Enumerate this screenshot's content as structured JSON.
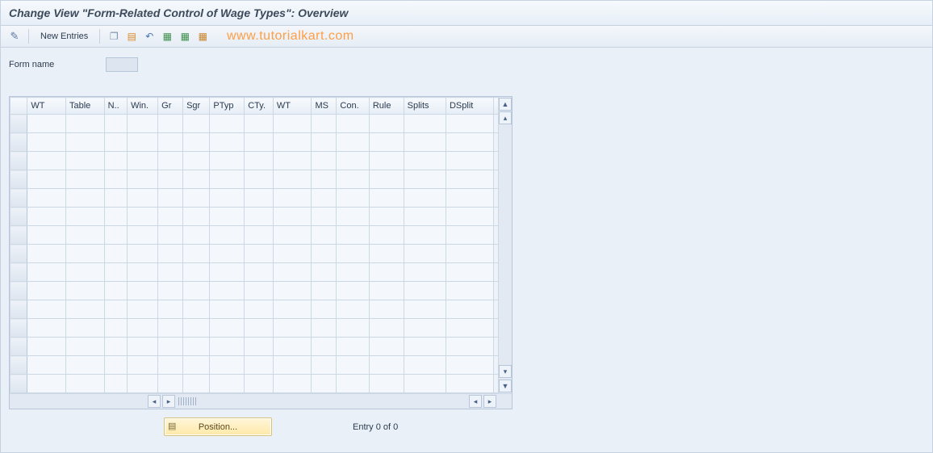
{
  "title": "Change View \"Form-Related Control of Wage Types\": Overview",
  "toolbar": {
    "new_entries_label": "New Entries"
  },
  "watermark": "www.tutorialkart.com",
  "form": {
    "label": "Form name",
    "value": ""
  },
  "table": {
    "columns": [
      "WT",
      "Table",
      "N..",
      "Win.",
      "Gr",
      "Sgr",
      "PTyp",
      "CTy.",
      "WT",
      "MS",
      "Con.",
      "Rule",
      "Splits",
      "DSplit"
    ],
    "row_count": 15
  },
  "footer": {
    "position_label": "Position...",
    "entry_text": "Entry 0 of 0"
  }
}
